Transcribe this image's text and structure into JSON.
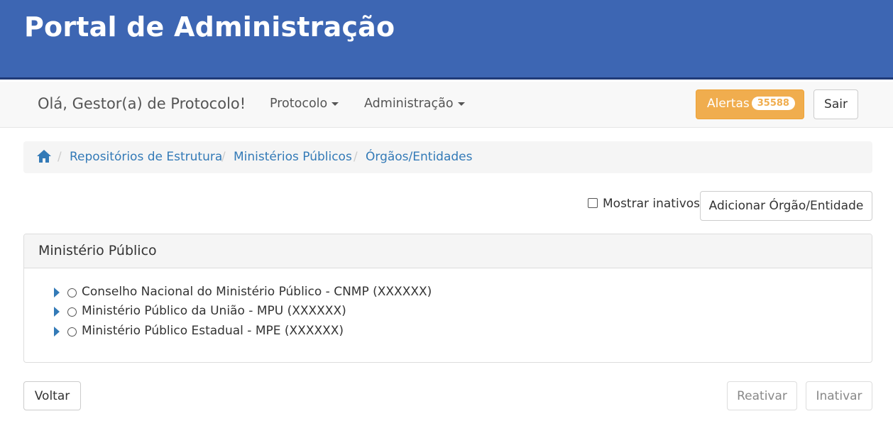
{
  "header": {
    "title": "Portal de Administração"
  },
  "navbar": {
    "greeting": "Olá, Gestor(a) de Protocolo!",
    "menus": [
      {
        "label": "Protocolo"
      },
      {
        "label": "Administração"
      }
    ],
    "alerts": {
      "label": "Alertas",
      "count": "35588"
    },
    "logout_label": "Sair"
  },
  "breadcrumb": {
    "home_icon": "home-icon",
    "items": [
      "Repositórios de Estrutura",
      "Ministérios Públicos",
      "Órgãos/Entidades"
    ]
  },
  "toolbar": {
    "show_inactive_label": "Mostrar inativos",
    "show_inactive_checked": false,
    "add_label": "Adicionar Órgão/Entidade"
  },
  "panel": {
    "title": "Ministério Público",
    "items": [
      {
        "label": "Conselho Nacional do Ministério Público - CNMP (XXXXXX)"
      },
      {
        "label": "Ministério Público da União - MPU (XXXXXX)"
      },
      {
        "label": "Ministério Público Estadual - MPE (XXXXXX)"
      }
    ]
  },
  "footer": {
    "back_label": "Voltar",
    "reactivate_label": "Reativar",
    "inactivate_label": "Inativar"
  },
  "colors": {
    "header_bg": "#3d66b3",
    "link": "#337ab7",
    "alert": "#f0ad4e"
  }
}
